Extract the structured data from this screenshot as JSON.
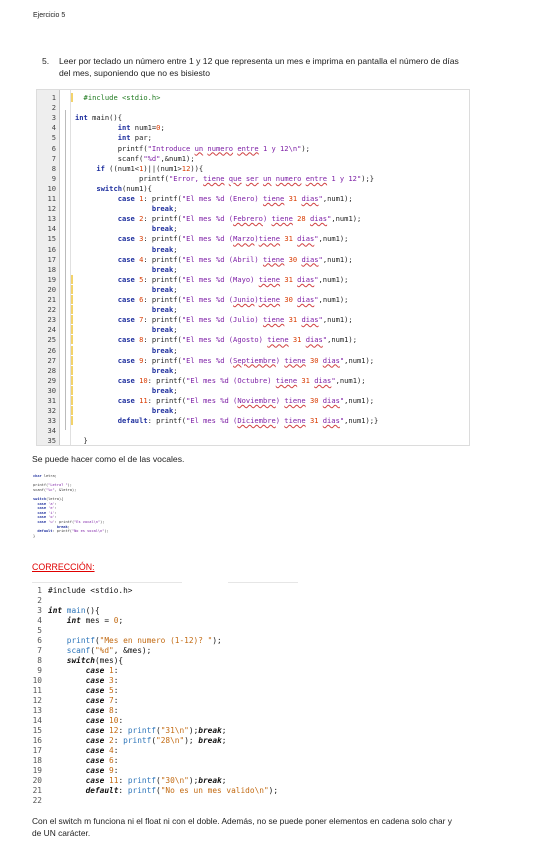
{
  "header": {
    "title": "Ejercicio 5"
  },
  "exercise": {
    "number": "5.",
    "statement": "Leer por teclado un número entre 1 y 12 que representa un mes e imprima en pantalla el número de días del mes, suponiendo que no es bisiesto"
  },
  "code1": {
    "lines": [
      "  #include <stdio.h>",
      "",
      "int main(){",
      "          int num1=0;",
      "          int par;",
      "          printf(\"Introduce un numero entre 1 y 12\\n\");",
      "          scanf(\"%d\",&num1);",
      "     if ((num1<1)||(num1>12)){",
      "               printf(\"Error, tiene que ser un numero entre 1 y 12\");}",
      "     switch(num1){",
      "          case 1: printf(\"El mes %d (Enero) tiene 31 dias\",num1);",
      "                  break;",
      "          case 2: printf(\"El mes %d (Febrero) tiene 28 dias\",num1);",
      "                  break;",
      "          case 3: printf(\"El mes %d (Marzo)tiene 31 dias\",num1);",
      "                  break;",
      "          case 4: printf(\"El mes %d (Abril) tiene 30 dias\",num1);",
      "                  break;",
      "          case 5: printf(\"El mes %d (Mayo) tiene 31 dias\",num1);",
      "                  break;",
      "          case 6: printf(\"El mes %d (Junio)tiene 30 dias\",num1);",
      "                  break;",
      "          case 7: printf(\"El mes %d (Julio) tiene 31 dias\",num1);",
      "                  break;",
      "          case 8: printf(\"El mes %d (Agosto) tiene 31 dias\",num1);",
      "                  break;",
      "          case 9: printf(\"El mes %d (Septiembre) tiene 30 dias\",num1);",
      "                  break;",
      "          case 10: printf(\"El mes %d (Octubre) tiene 31 dias\",num1);",
      "                  break;",
      "          case 11: printf(\"El mes %d (Noviembre) tiene 30 dias\",num1);",
      "                  break;",
      "          default: printf(\"El mes %d (Diciembre) tiene 31 dias\",num1);}",
      "",
      "  }"
    ]
  },
  "note1": "Se puede hacer como el de las vocales.",
  "tiny_code": {
    "lines": [
      "char letra;",
      "",
      "printf(\"Letra? \");",
      "scanf(\"%c\", &letra);",
      "",
      "switch(letra){",
      "  case 'a':",
      "  case 'e':",
      "  case 'i':",
      "  case 'o':",
      "  case 'u': printf(\"Es vocal\\n\");",
      "           break;",
      "  default: printf(\"No es vocal\\n\");",
      "}"
    ]
  },
  "correction_label": "CORRECCIÓN:",
  "code2": {
    "lines": [
      "#include <stdio.h>",
      "",
      "int main(){",
      "    int mes = 0;",
      "",
      "    printf(\"Mes en numero (1-12)? \");",
      "    scanf(\"%d\", &mes);",
      "    switch(mes){",
      "        case 1:",
      "        case 3:",
      "        case 5:",
      "        case 7:",
      "        case 8:",
      "        case 10:",
      "        case 12: printf(\"31\\n\");break;",
      "        case 2: printf(\"28\\n\"); break;",
      "        case 4:",
      "        case 6:",
      "        case 9:",
      "        case 11: printf(\"30\\n\");break;",
      "        default: printf(\"No es un mes valido\\n\");",
      ""
    ]
  },
  "note2": "Con el switch m funciona ni el float ni con el doble. Además, no se puede poner elementos en cadena solo char y de UN carácter."
}
